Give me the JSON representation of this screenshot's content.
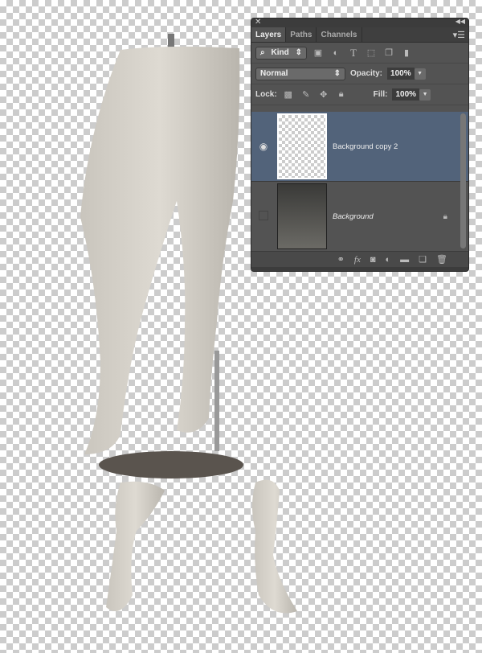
{
  "panel": {
    "tabs": [
      "Layers",
      "Paths",
      "Channels"
    ],
    "filter": {
      "kind_label": "Kind"
    },
    "blend_mode": "Normal",
    "opacity_label": "Opacity:",
    "opacity_value": "100%",
    "lock_label": "Lock:",
    "fill_label": "Fill:",
    "fill_value": "100%",
    "layers": [
      {
        "name": "Background copy 2",
        "visible": true,
        "selected": true
      },
      {
        "name": "Background",
        "visible": false,
        "locked": true
      }
    ]
  },
  "colors": {
    "panel_bg": "#535353",
    "selected_layer": "#52637a"
  }
}
